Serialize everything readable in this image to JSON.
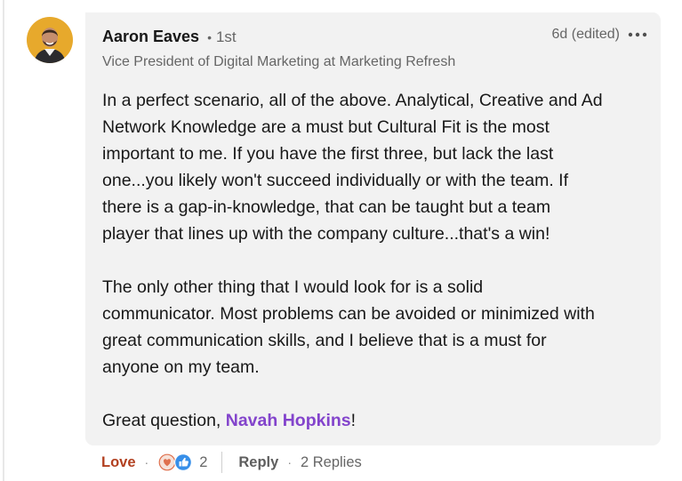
{
  "comment": {
    "author": "Aaron Eaves",
    "degree_separator": "•",
    "degree": "1st",
    "headline": "Vice President of Digital Marketing at Marketing Refresh",
    "time": "6d (edited)",
    "body_paragraphs": [
      [
        "In a perfect scenario, all of the above. Analytical, Creative and Ad",
        "Network Knowledge are a must but Cultural Fit is the most",
        "important to me. If you have the first three, but lack the last",
        "one...you likely won't succeed individually or with the team. If",
        "there is a gap-in-knowledge, that can be taught but a team",
        "player that lines up with the company culture...that's a win!"
      ],
      [
        "The only other thing that I would look for is a solid",
        "communicator. Most problems can be avoided or minimized with",
        "great communication skills, and I believe that is a must for",
        "anyone on my team."
      ]
    ],
    "closing": {
      "prefix": "Great question, ",
      "mention": "Navah Hopkins",
      "suffix": "!"
    }
  },
  "actions": {
    "reaction_label": "Love",
    "separator": "·",
    "reaction_count": "2",
    "reply_label": "Reply",
    "replies_label": "2 Replies"
  },
  "icons": {
    "more": "more-horizontal-icon",
    "love": "love-reaction-icon",
    "like": "like-reaction-icon"
  },
  "colors": {
    "bubble": "#f2f2f2",
    "mention": "#8344cc",
    "love": "#b24020",
    "like": "#378fe9",
    "avatar_bg": "#e7a92c"
  }
}
